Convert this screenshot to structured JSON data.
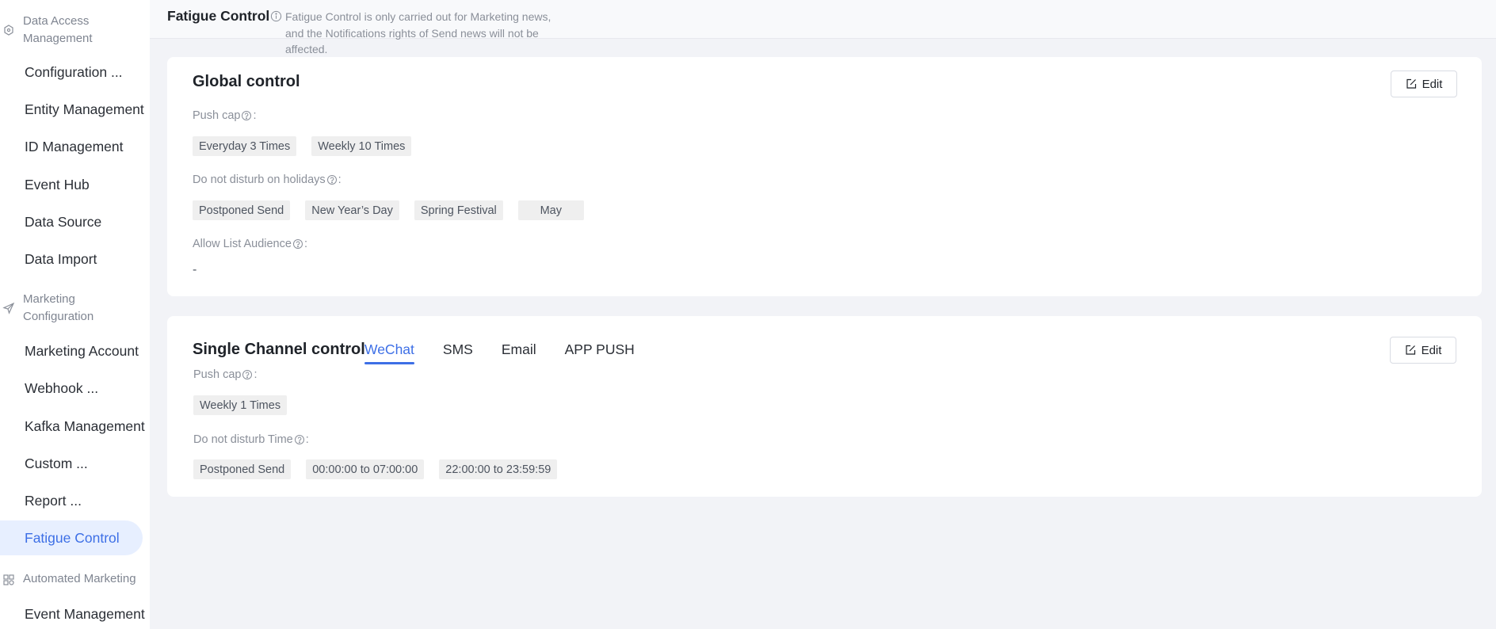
{
  "sidebar": {
    "groups": [
      {
        "label": "Data Access Management",
        "icon": "data-access-icon"
      },
      {
        "label": "Marketing Configuration",
        "icon": "send-icon"
      },
      {
        "label": "Automated Marketing",
        "icon": "automation-icon"
      }
    ],
    "items": [
      {
        "label": "Configuration ..."
      },
      {
        "label": "Entity Management"
      },
      {
        "label": "ID Management"
      },
      {
        "label": "Event Hub"
      },
      {
        "label": "Data Source"
      },
      {
        "label": "Data Import"
      },
      {
        "label": "Marketing Account"
      },
      {
        "label": "Webhook ..."
      },
      {
        "label": "Kafka Management"
      },
      {
        "label": "Custom ..."
      },
      {
        "label": "Report ..."
      },
      {
        "label": "Fatigue Control",
        "active": true
      },
      {
        "label": "Event Management"
      }
    ]
  },
  "header": {
    "title": "Fatigue Control",
    "notice": "Fatigue Control is only carried out for Marketing news, and the Notifications rights of Send news will not be affected."
  },
  "global_control": {
    "title": "Global control",
    "edit_label": "Edit",
    "push_cap_label": "Push cap",
    "push_cap_tags": [
      "Everyday 3 Times",
      "Weekly 10 Times"
    ],
    "dnd_holidays_label": "Do not disturb on holidays",
    "dnd_holidays_tags": [
      "Postponed Send",
      "New Year’s Day",
      "Spring Festival",
      "May"
    ],
    "allow_list_label": "Allow List Audience",
    "allow_list_value": "-"
  },
  "single_channel": {
    "title": "Single Channel control",
    "edit_label": "Edit",
    "tabs": [
      "WeChat",
      "SMS",
      "Email",
      "APP PUSH"
    ],
    "active_tab": "WeChat",
    "push_cap_label": "Push cap",
    "push_cap_tags": [
      "Weekly 1 Times"
    ],
    "dnd_time_label": "Do not disturb Time",
    "dnd_time_tags": [
      "Postponed Send",
      "00:00:00 to 07:00:00",
      "22:00:00 to 23:59:59"
    ]
  },
  "colors": {
    "accent": "#3d6fe6",
    "active_bg": "#e7efff",
    "page_bg": "#f2f3f7"
  }
}
